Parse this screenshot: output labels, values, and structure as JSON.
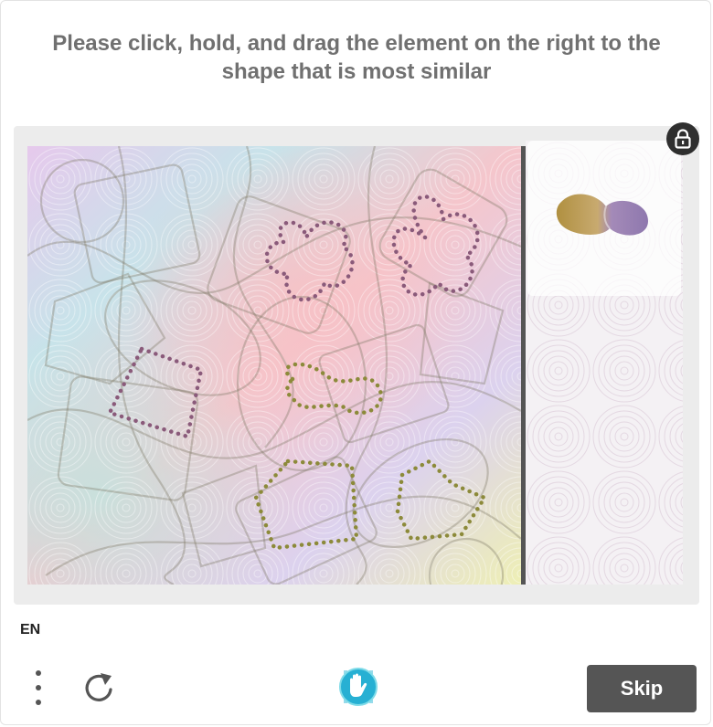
{
  "prompt": {
    "line1": "Please click, hold, and drag the element on the right to the",
    "line2": "shape that is most similar"
  },
  "footer": {
    "language": "EN",
    "skip_label": "Skip"
  },
  "icons": {
    "lock": "lock-icon",
    "menu": "vertical-dots-icon",
    "refresh": "refresh-icon",
    "brand": "hand-logo-icon"
  },
  "colors": {
    "skip_button": "#555555",
    "prompt_text": "#707070",
    "task_background": "#ececec",
    "divider": "#555555",
    "dot_shape_purple": "#8a5a7a",
    "dot_shape_olive": "#8c8a3a"
  }
}
